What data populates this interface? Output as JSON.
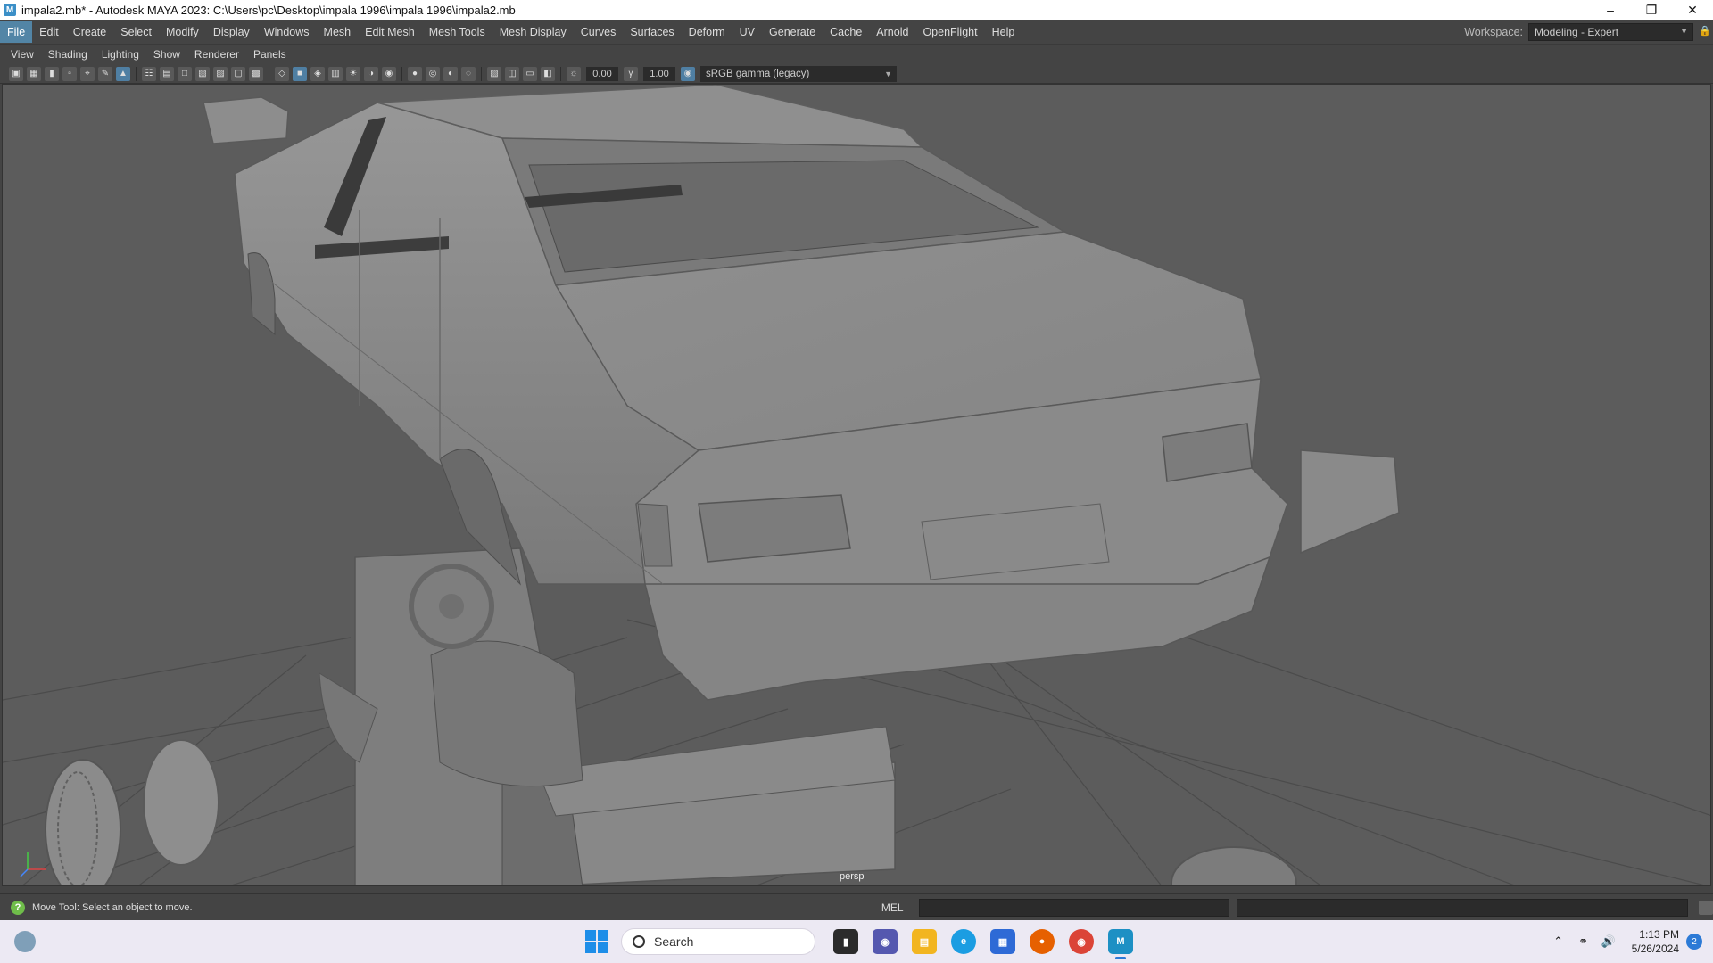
{
  "window": {
    "title": "impala2.mb* - Autodesk MAYA 2023: C:\\Users\\pc\\Desktop\\impala 1996\\impala 1996\\impala2.mb",
    "app_icon": "M"
  },
  "menubar": {
    "items": [
      "File",
      "Edit",
      "Create",
      "Select",
      "Modify",
      "Display",
      "Windows",
      "Mesh",
      "Edit Mesh",
      "Mesh Tools",
      "Mesh Display",
      "Curves",
      "Surfaces",
      "Deform",
      "UV",
      "Generate",
      "Cache",
      "Arnold",
      "OpenFlight",
      "Help"
    ],
    "active": "File",
    "workspace_label": "Workspace:",
    "workspace_value": "Modeling - Expert"
  },
  "panel_menu": {
    "items": [
      "View",
      "Shading",
      "Lighting",
      "Show",
      "Renderer",
      "Panels"
    ]
  },
  "panel_toolbar": {
    "exposure": "0.00",
    "gamma": "1.00",
    "color_space": "sRGB gamma (legacy)"
  },
  "viewport": {
    "camera": "persp",
    "background_color": "#5c5c5c",
    "grid_color": "#4a4a4a",
    "mesh_color": "#8a8a8a"
  },
  "helpline": {
    "text": "Move Tool: Select an object to move.",
    "command_language": "MEL"
  },
  "taskbar": {
    "search_placeholder": "Search",
    "time": "1:13 PM",
    "date": "5/26/2024",
    "notifications": "2",
    "apps": [
      "terminal-icon",
      "meet-icon",
      "file-explorer-icon",
      "edge-icon",
      "store-icon",
      "firefox-icon",
      "chrome-icon",
      "maya-icon"
    ]
  }
}
